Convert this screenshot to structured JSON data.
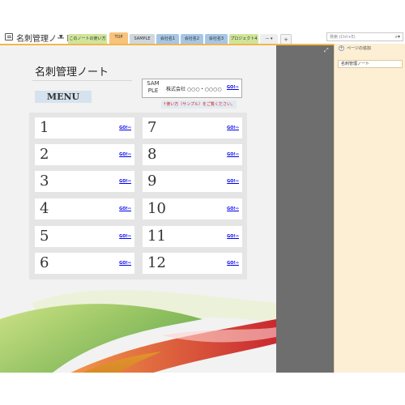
{
  "app": {
    "notebook_title": "名刺管理ノート"
  },
  "tabs": [
    {
      "label": "このノートの使い方",
      "color": "#cfe59a",
      "active": false
    },
    {
      "label": "TOP",
      "color": "#f8c37a",
      "active": true
    },
    {
      "label": "SAMPLE",
      "color": "#cfd7de",
      "active": false
    },
    {
      "label": "会社名1",
      "color": "#a7c6e6",
      "active": false
    },
    {
      "label": "会社名2",
      "color": "#a7c6e6",
      "active": false
    },
    {
      "label": "会社名3",
      "color": "#a7c6e6",
      "active": false
    },
    {
      "label": "プロジェクト4",
      "color": "#cfe59a",
      "active": false
    },
    {
      "label": "— ▾",
      "color": "#eeeeee",
      "active": false
    },
    {
      "label": "+",
      "color": "#f4f4f4",
      "active": false
    }
  ],
  "search": {
    "placeholder": "検索 (Ctrl+E)",
    "icon": "magnifier-icon"
  },
  "sidebar": {
    "add_page_label": "ページの追加",
    "pages": [
      "名刺管理ノート"
    ]
  },
  "page": {
    "title": "名刺管理ノート",
    "menu_label": "MENU",
    "sample": {
      "logo_line1": "SAM",
      "logo_line2": "PLE",
      "company": "株式会社 ○○○・○○○○",
      "go": "GO!⇨"
    },
    "howto_link": "↑使い方（サンプル）をご覧ください。",
    "items": [
      {
        "num": "1",
        "go": "GO!⇨"
      },
      {
        "num": "7",
        "go": "GO!⇨"
      },
      {
        "num": "2",
        "go": "GO!⇨"
      },
      {
        "num": "8",
        "go": "GO!⇨"
      },
      {
        "num": "3",
        "go": "GO!⇨"
      },
      {
        "num": "9",
        "go": "GO!⇨"
      },
      {
        "num": "4",
        "go": "GO!⇨"
      },
      {
        "num": "10",
        "go": "GO!⇨"
      },
      {
        "num": "5",
        "go": "GO!⇨"
      },
      {
        "num": "11",
        "go": "GO!⇨"
      },
      {
        "num": "6",
        "go": "GO!⇨"
      },
      {
        "num": "12",
        "go": "GO!⇨"
      }
    ]
  },
  "colors": {
    "accent_yellow": "#f2b74a",
    "sidebar_bg": "#fcefd4",
    "link": "#0000ee",
    "menu_badge": "#d6e2ee"
  }
}
